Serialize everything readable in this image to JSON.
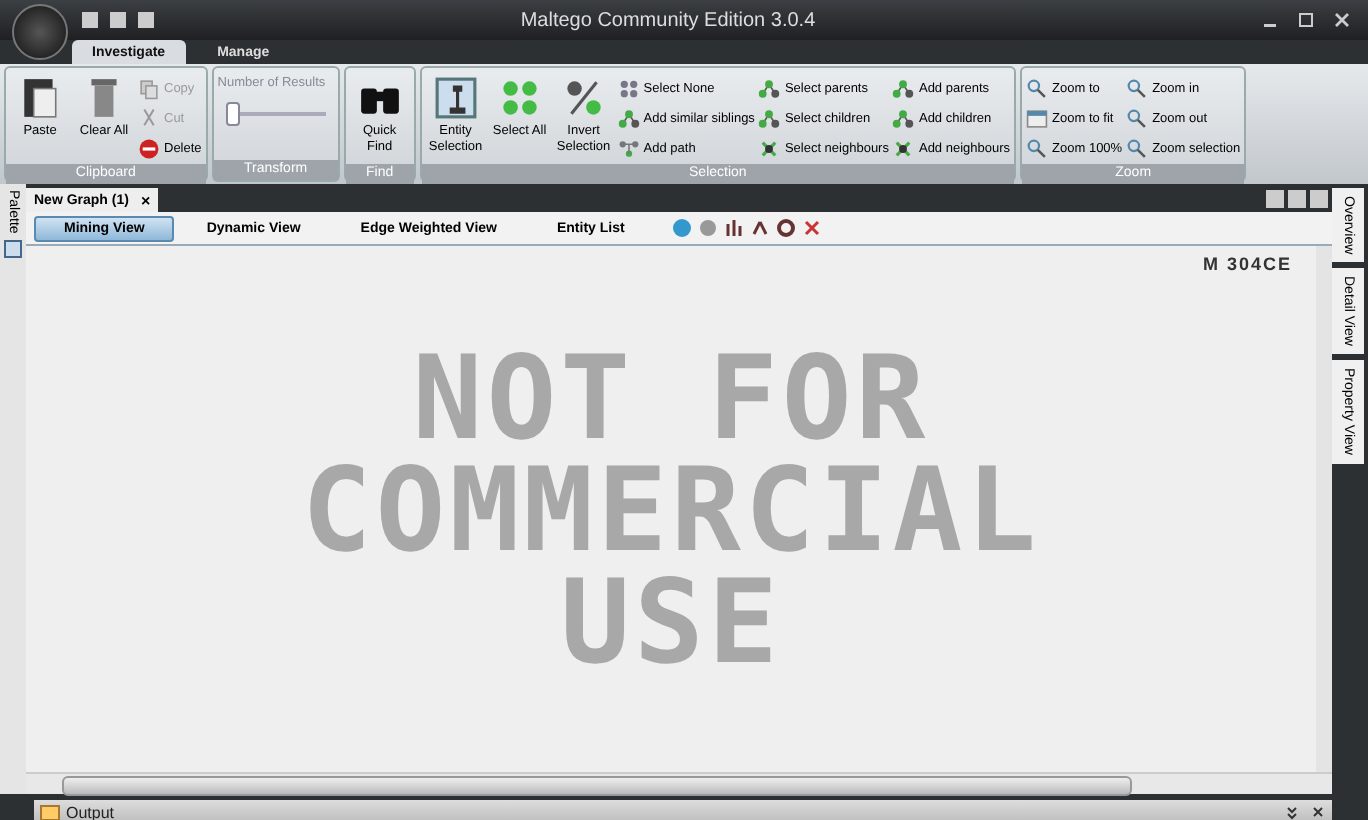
{
  "window": {
    "title": "Maltego Community Edition 3.0.4"
  },
  "ribbon_tabs": [
    {
      "label": "Investigate",
      "selected": true
    },
    {
      "label": "Manage",
      "selected": false
    }
  ],
  "ribbon_groups": [
    {
      "title": "Clipboard",
      "items": [
        {
          "kind": "large",
          "label": "Paste",
          "disabled": false
        },
        {
          "kind": "large",
          "label": "Clear All",
          "disabled": false
        },
        {
          "kind": "small",
          "label": "Copy",
          "disabled": true
        },
        {
          "kind": "small",
          "label": "Cut",
          "disabled": true
        },
        {
          "kind": "small",
          "label": "Delete",
          "disabled": false
        }
      ]
    },
    {
      "title": "Transform",
      "items": [
        {
          "kind": "slider",
          "label": "Number of Results",
          "level": 0
        }
      ]
    },
    {
      "title": "Find",
      "items": [
        {
          "kind": "large",
          "label": "Quick Find",
          "disabled": false
        }
      ]
    },
    {
      "title": "Selection",
      "items": [
        {
          "kind": "large",
          "label": "Entity Selection",
          "disabled": false
        },
        {
          "kind": "large",
          "label": "Select All",
          "disabled": false
        },
        {
          "kind": "large",
          "label": "Invert Selection",
          "disabled": false
        },
        {
          "kind": "small",
          "label": "Select None",
          "disabled": false
        },
        {
          "kind": "small",
          "label": "Add similar siblings",
          "disabled": false
        },
        {
          "kind": "small",
          "label": "Add path",
          "disabled": false
        },
        {
          "kind": "small",
          "label": "Select parents",
          "disabled": false
        },
        {
          "kind": "small",
          "label": "Select children",
          "disabled": false
        },
        {
          "kind": "small",
          "label": "Select neighbours",
          "disabled": false
        },
        {
          "kind": "small",
          "label": "Add parents",
          "disabled": false
        },
        {
          "kind": "small",
          "label": "Add children",
          "disabled": false
        },
        {
          "kind": "small",
          "label": "Add neighbours",
          "disabled": false
        }
      ]
    },
    {
      "title": "Zoom",
      "items": [
        {
          "kind": "small",
          "label": "Zoom to",
          "disabled": false
        },
        {
          "kind": "small",
          "label": "Zoom to fit",
          "disabled": false
        },
        {
          "kind": "small",
          "label": "Zoom 100%",
          "disabled": false
        },
        {
          "kind": "small",
          "label": "Zoom in",
          "disabled": false
        },
        {
          "kind": "small",
          "label": "Zoom out",
          "disabled": false
        },
        {
          "kind": "small",
          "label": "Zoom selection",
          "disabled": false
        }
      ]
    }
  ],
  "left_panel": {
    "label": "Palette"
  },
  "document_tab": {
    "label": "New Graph (1)",
    "close": "×"
  },
  "view_tabs": [
    {
      "label": "Mining View",
      "selected": true
    },
    {
      "label": "Dynamic View",
      "selected": false
    },
    {
      "label": "Edge Weighted View",
      "selected": false
    },
    {
      "label": "Entity List",
      "selected": false
    }
  ],
  "canvas": {
    "version_mark": "M 304CE",
    "watermark": [
      "NOT FOR",
      "COMMERCIAL",
      "USE"
    ]
  },
  "right_panels": [
    {
      "label": "Overview"
    },
    {
      "label": "Detail View"
    },
    {
      "label": "Property View"
    }
  ],
  "output": {
    "title": "Output"
  }
}
